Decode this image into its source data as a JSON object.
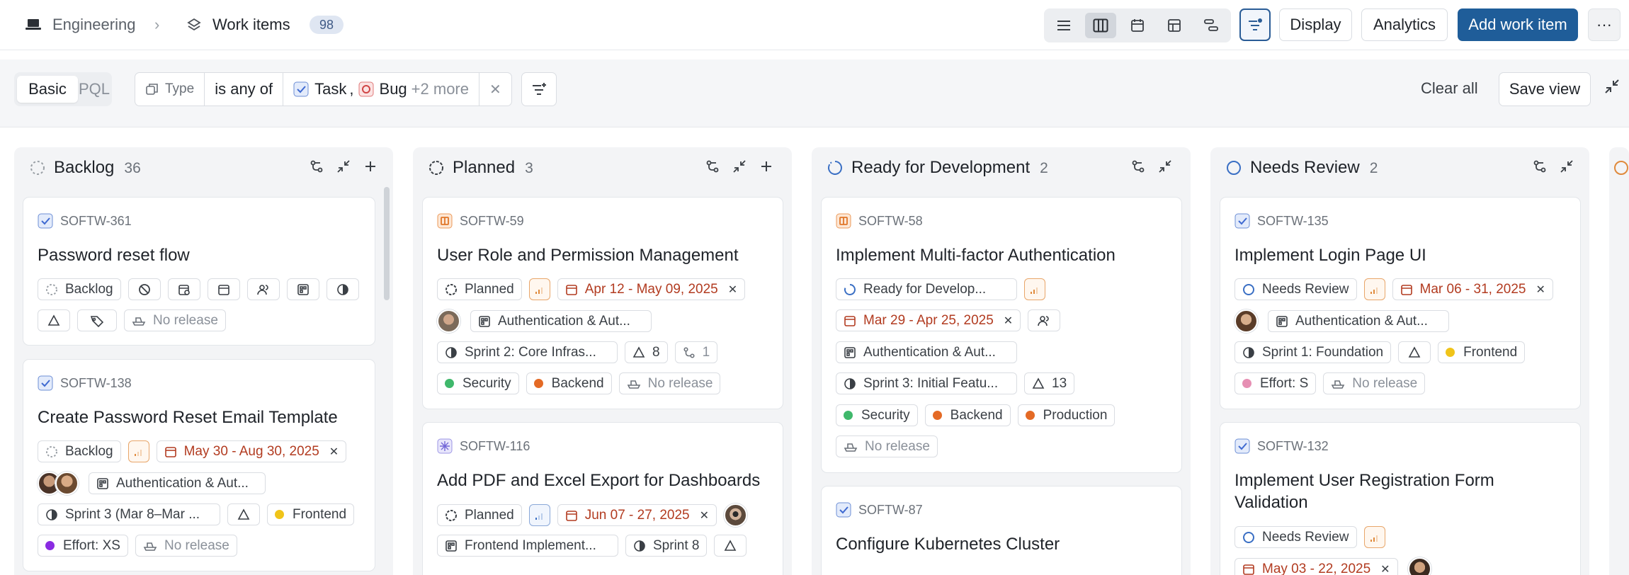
{
  "breadcrumb": {
    "project": "Engineering",
    "separator": "›",
    "page": "Work items",
    "count": "98"
  },
  "toolbar": {
    "display": "Display",
    "analytics": "Analytics",
    "add_work_item": "Add work item",
    "more": "···"
  },
  "filters": {
    "mode_basic": "Basic",
    "mode_pql": "PQL",
    "field": "Type",
    "operator": "is any of",
    "value1": "Task",
    "value_sep": ",",
    "value2": "Bug",
    "more": "+2 more",
    "clear_all": "Clear all",
    "save_view": "Save view"
  },
  "colors": {
    "accent": "#1f5d99",
    "date_red": "#b23b20",
    "priority_orange": "#e08a3c"
  },
  "columns": [
    {
      "title": "Backlog",
      "count": "36",
      "cards": [
        {
          "id": "SOFTW-361",
          "title": "Password reset flow",
          "status": "Backlog",
          "release": "No release"
        },
        {
          "id": "SOFTW-138",
          "title": "Create Password Reset Email Template",
          "status": "Backlog",
          "date": "May 30 - Aug 30, 2025",
          "module": "Authentication & Aut...",
          "cycle": "Sprint 3 (Mar 8–Mar ...",
          "label1": "Frontend",
          "effort": "Effort: XS",
          "release": "No release"
        }
      ]
    },
    {
      "title": "Planned",
      "count": "3",
      "cards": [
        {
          "id": "SOFTW-59",
          "title": "User Role and Permission Management",
          "status": "Planned",
          "date": "Apr 12 - May 09, 2025",
          "module": "Authentication & Aut...",
          "cycle": "Sprint 2: Core Infras...",
          "estimate": "8",
          "sub": "1",
          "label1": "Security",
          "label2": "Backend",
          "release": "No release"
        },
        {
          "id": "SOFTW-116",
          "title": "Add PDF and Excel Export for Dashboards",
          "status": "Planned",
          "date": "Jun 07 - 27, 2025",
          "module": "Frontend Implement...",
          "cycle": "Sprint 8"
        }
      ]
    },
    {
      "title": "Ready for Development",
      "count": "2",
      "cards": [
        {
          "id": "SOFTW-58",
          "title": "Implement Multi-factor Authentication",
          "status": "Ready for Develop...",
          "date": "Mar 29 - Apr 25, 2025",
          "module": "Authentication & Aut...",
          "cycle": "Sprint 3: Initial Featu...",
          "estimate": "13",
          "label1": "Security",
          "label2": "Backend",
          "label3": "Production",
          "release": "No release"
        },
        {
          "id": "SOFTW-87",
          "title": "Configure Kubernetes Cluster"
        }
      ]
    },
    {
      "title": "Needs Review",
      "count": "2",
      "cards": [
        {
          "id": "SOFTW-135",
          "title": "Implement Login Page UI",
          "status": "Needs Review",
          "date": "Mar 06 - 31, 2025",
          "module": "Authentication & Aut...",
          "cycle": "Sprint 1: Foundation",
          "label1": "Frontend",
          "effort": "Effort: S",
          "release": "No release"
        },
        {
          "id": "SOFTW-132",
          "title_line1": "Implement User Registration Form",
          "title_line2": "Validation",
          "status": "Needs Review",
          "date": "May 03 - 22, 2025"
        }
      ]
    }
  ]
}
